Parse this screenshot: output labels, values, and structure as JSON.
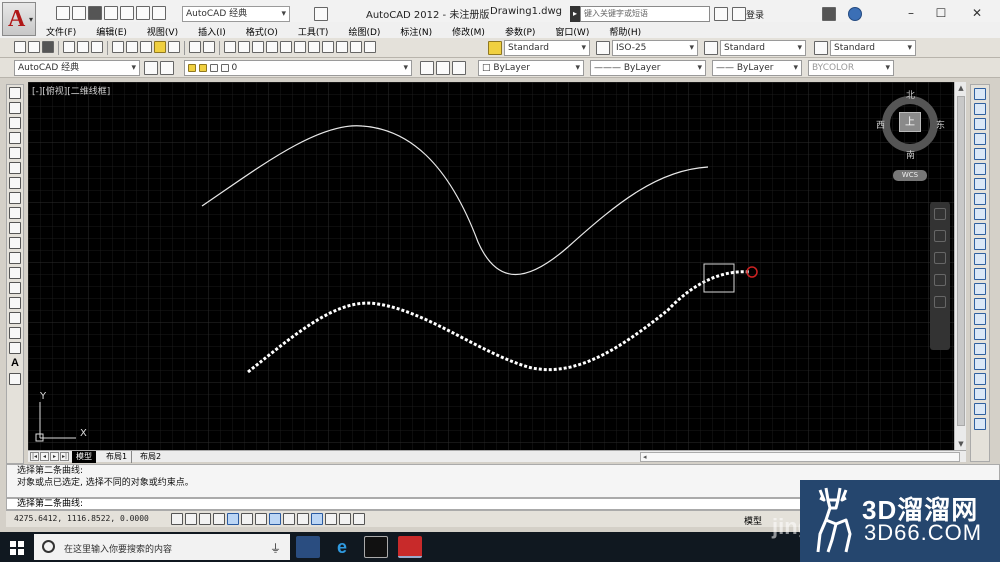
{
  "titlebar": {
    "workspace": "AutoCAD 经典",
    "app_title": "AutoCAD 2012 - 未注册版",
    "doc_title": "Drawing1.dwg",
    "search_placeholder": "键入关键字或短语",
    "login": "登录"
  },
  "menu": [
    "文件(F)",
    "编辑(E)",
    "视图(V)",
    "插入(I)",
    "格式(O)",
    "工具(T)",
    "绘图(D)",
    "标注(N)",
    "修改(M)",
    "参数(P)",
    "窗口(W)",
    "帮助(H)"
  ],
  "toolbar_styles": {
    "text_style": "Standard",
    "dim_style": "ISO-25",
    "table_style": "Standard",
    "multileader_style": "Standard"
  },
  "toolbar_layers": {
    "workspace": "AutoCAD 经典",
    "layer": "0",
    "color": "ByLayer",
    "linetype": "ByLayer",
    "lineweight": "ByLayer",
    "plotstyle": "BYCOLOR"
  },
  "viewport": {
    "label": "[-][俯视][二维线框]",
    "background": "#000000",
    "curve_color": "#e8e8e8"
  },
  "compass": {
    "north": "北",
    "south": "南",
    "east": "东",
    "west": "西",
    "top": "上",
    "wcs": "WCS"
  },
  "ucs": {
    "x": "X",
    "y": "Y"
  },
  "tabs": {
    "model": "模型",
    "layout1": "布局1",
    "layout2": "布局2"
  },
  "command": {
    "history": [
      "选择第二条曲线:",
      "对象或点已选定, 选择不同的对象或约束点。"
    ],
    "prompt": "选择第二条曲线:"
  },
  "status": {
    "coords": "4275.6412, 1116.8522, 0.0000",
    "model": "模型"
  },
  "taskbar": {
    "search_placeholder": "在这里输入你要搜索的内容"
  },
  "watermark": {
    "title": "3D溜溜网",
    "subtitle": "3D66.COM",
    "partial": "jing"
  }
}
